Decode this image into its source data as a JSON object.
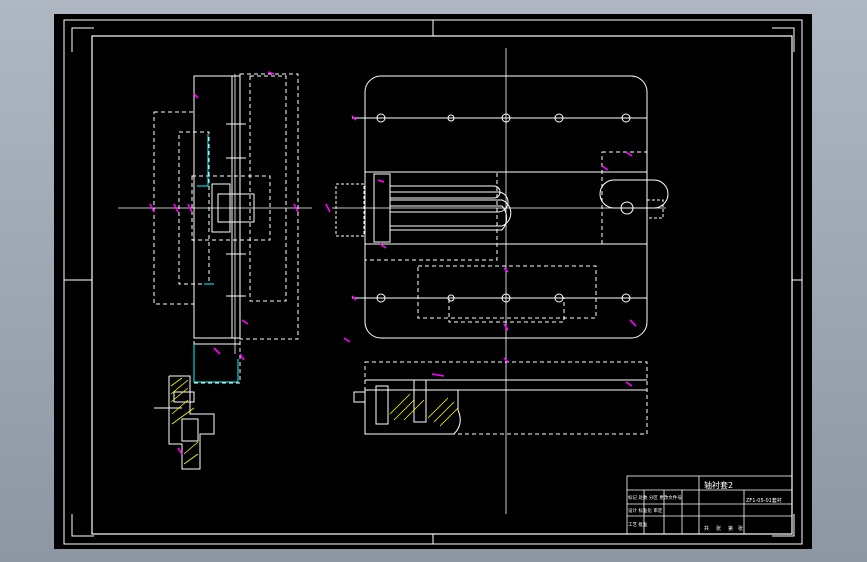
{
  "title_block": {
    "drawing_name": "轴衬套2",
    "title_text": "ZF1-05-01套衬",
    "row_labels": [
      "标记 处数 分区 更改文件号",
      "设计 标准化 审定",
      "工艺 批准"
    ],
    "bottom_labels": [
      "共",
      "张",
      "第",
      "张"
    ]
  },
  "colors": {
    "background": "#000000",
    "line": "#ffffff",
    "dimension": "#ff00ff",
    "hatch": "#ffff00",
    "accent": "#00ffff",
    "frame_outer": "#aeb7c2"
  }
}
